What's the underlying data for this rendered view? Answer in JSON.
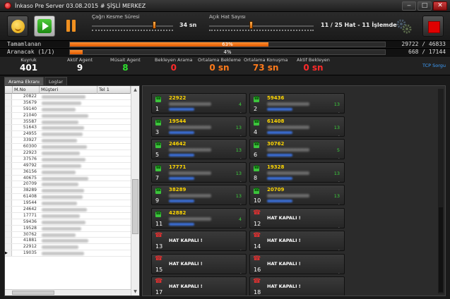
{
  "window": {
    "title": "İnkaso Pre Server 03.08.2015 # ŞİŞLİ MERKEZ",
    "min": "‒",
    "max": "□",
    "close": "✕"
  },
  "toolbar": {
    "call_timeout_label": "Çağrı Kesme Süresi",
    "call_timeout_value": "34 sn",
    "open_lines_label": "Açık Hat Sayısı",
    "open_lines_value": "11 / 25 Hat - 11 İşlemde"
  },
  "progress": [
    {
      "label": "Tamamlanan",
      "percent_text": "63%",
      "fraction": 0.63,
      "value": "29722 / 46833"
    },
    {
      "label": "Aranacak (1/1)",
      "percent_text": "4%",
      "fraction": 0.04,
      "value": "668 / 17144"
    }
  ],
  "stats": [
    {
      "label": "Kuyruk",
      "value": "401",
      "color": "#ffffff"
    },
    {
      "label": "Aktif Agent",
      "value": "9",
      "color": "#ffffff"
    },
    {
      "label": "Müsait Agent",
      "value": "8",
      "color": "#2ee02e"
    },
    {
      "label": "Bekleyen Arama",
      "value": "0",
      "color": "#ff2a2a"
    },
    {
      "label": "Ortalama Bekleme",
      "value": "0 sn",
      "color": "#ff7a1a"
    },
    {
      "label": "Ortalama Konuşma",
      "value": "73 sn",
      "color": "#ff7a1a"
    },
    {
      "label": "Aktif Bekleyen",
      "value": "0 sn",
      "color": "#ff2a2a"
    }
  ],
  "tcp_link": "TCP Sorgu",
  "tabs": [
    "Arama Ekranı",
    "Loglar"
  ],
  "grid": {
    "headers": [
      "M.No",
      "Müşteri",
      "Tel 1"
    ],
    "rows": [
      "20822",
      "35679",
      "59140",
      "21040",
      "35587",
      "51643",
      "24955",
      "33927",
      "60300",
      "22923",
      "37576",
      "49792",
      "36156",
      "40675",
      "20709",
      "38289",
      "61408",
      "19544",
      "24642",
      "17771",
      "59436",
      "19528",
      "30762",
      "41881",
      "22912",
      "19035"
    ]
  },
  "channels": [
    {
      "idx": "1",
      "num": "22922",
      "dur": "4",
      "state": "active"
    },
    {
      "idx": "2",
      "num": "59436",
      "dur": "13",
      "state": "active"
    },
    {
      "idx": "3",
      "num": "19544",
      "dur": "13",
      "state": "active"
    },
    {
      "idx": "4",
      "num": "61408",
      "dur": "13",
      "state": "active"
    },
    {
      "idx": "5",
      "num": "24642",
      "dur": "13",
      "state": "active"
    },
    {
      "idx": "6",
      "num": "30762",
      "dur": "5",
      "state": "active"
    },
    {
      "idx": "7",
      "num": "17771",
      "dur": "13",
      "state": "active"
    },
    {
      "idx": "8",
      "num": "19328",
      "dur": "13",
      "state": "active"
    },
    {
      "idx": "9",
      "num": "38289",
      "dur": "13",
      "state": "active"
    },
    {
      "idx": "10",
      "num": "20709",
      "dur": "13",
      "state": "active"
    },
    {
      "idx": "11",
      "num": "42882",
      "dur": "4",
      "state": "active"
    },
    {
      "idx": "12",
      "num": "HAT KAPALI !",
      "dur": "",
      "state": "closed"
    },
    {
      "idx": "13",
      "num": "HAT KAPALI !",
      "dur": "",
      "state": "closed"
    },
    {
      "idx": "14",
      "num": "HAT KAPALI !",
      "dur": "",
      "state": "closed"
    },
    {
      "idx": "15",
      "num": "HAT KAPALI !",
      "dur": "",
      "state": "closed"
    },
    {
      "idx": "16",
      "num": "HAT KAPALI !",
      "dur": "",
      "state": "closed"
    },
    {
      "idx": "17",
      "num": "HAT KAPALI !",
      "dur": "",
      "state": "closed"
    },
    {
      "idx": "18",
      "num": "HAT KAPALI !",
      "dur": "",
      "state": "closed"
    }
  ]
}
